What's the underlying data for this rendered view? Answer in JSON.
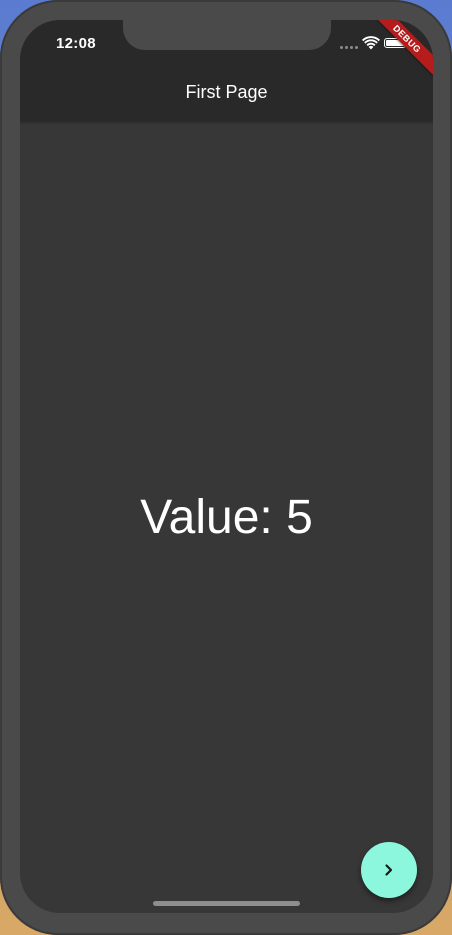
{
  "status_bar": {
    "time": "12:08",
    "icons": [
      "signal-icon",
      "wifi-icon",
      "battery-icon"
    ]
  },
  "debug_banner": {
    "label": "DEBUG",
    "color": "#b71c1c"
  },
  "app_bar": {
    "title": "First Page"
  },
  "body": {
    "value_text": "Value: 5"
  },
  "fab": {
    "icon": "chevron-right-icon",
    "color": "#8cf7dc"
  },
  "colors": {
    "app_bar_background": "#292929",
    "screen_background": "#373737",
    "accent": "#8cf7dc"
  }
}
